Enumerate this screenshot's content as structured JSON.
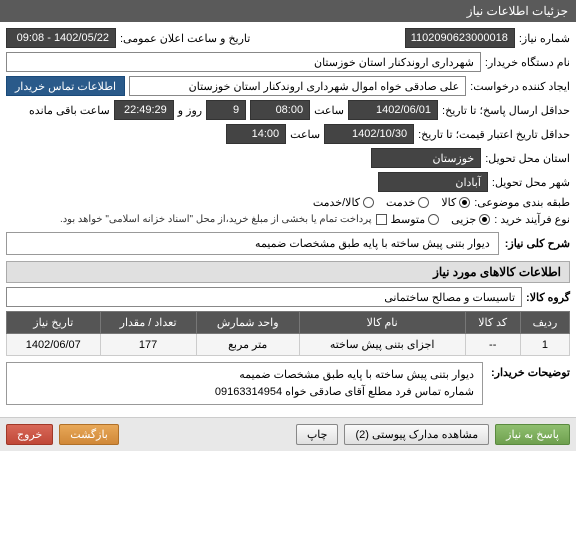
{
  "header": {
    "title": "جزئیات اطلاعات نیاز"
  },
  "fields": {
    "need_number_label": "شماره نیاز:",
    "need_number": "1102090623000018",
    "announce_label": "تاریخ و ساعت اعلان عمومی:",
    "announce_value": "1402/05/22 - 09:08",
    "buyer_org_label": "نام دستگاه خریدار:",
    "buyer_org": "شهرداری اروندکنار استان خوزستان",
    "requester_label": "ایجاد کننده درخواست:",
    "requester": "علی صادقی خواه اموال شهرداری اروندکنار استان خوزستان",
    "contact_btn": "اطلاعات تماس خریدار",
    "deadline_label": "حداقل ارسال پاسخ؛ تا تاریخ:",
    "deadline_date": "1402/06/01",
    "time_label": "ساعت",
    "deadline_time": "08:00",
    "days_value": "9",
    "days_label": "روز و",
    "remain_time": "22:49:29",
    "remain_label": "ساعت باقی مانده",
    "validity_label": "حداقل تاریخ اعتبار قیمت؛ تا تاریخ:",
    "validity_date": "1402/10/30",
    "validity_time": "14:00",
    "province_label": "استان محل تحویل:",
    "province": "خوزستان",
    "city_label": "شهر محل تحویل:",
    "city": "آبادان",
    "category_label": "طبقه بندی موضوعی:",
    "cat_goods": "کالا",
    "cat_service": "خدمت",
    "cat_goods_service": "کالا/خدمت",
    "process_label": "نوع فرآیند خرید :",
    "proc_partial": "جزیی",
    "proc_medium": "متوسط",
    "payment_note": "پرداخت تمام یا بخشی از مبلغ خرید،از محل \"اسناد خزانه اسلامی\" خواهد بود."
  },
  "desc": {
    "title_label": "شرح کلی نیاز:",
    "title_text": "دیوار بتنی پیش ساخته با پایه طبق مشخصات ضمیمه"
  },
  "items_section": {
    "heading": "اطلاعات کالاهای مورد نیاز",
    "group_label": "گروه کالا:",
    "group_value": "تاسیسات و مصالح ساختمانی"
  },
  "table": {
    "headers": {
      "row": "ردیف",
      "code": "کد کالا",
      "name": "نام کالا",
      "unit": "واحد شمارش",
      "qty": "تعداد / مقدار",
      "date": "تاریخ نیاز"
    },
    "rows": [
      {
        "row": "1",
        "code": "--",
        "name": "اجزای بتنی پیش ساخته",
        "unit": "متر مربع",
        "qty": "177",
        "date": "1402/06/07"
      }
    ]
  },
  "buyer_notes": {
    "label": "توضیحات خریدار:",
    "line1": "دیوار بتنی پیش ساخته با پایه طبق مشخصات ضمیمه",
    "line2": "شماره تماس فرد مطلع آقای صادقی خواه 09163314954"
  },
  "footer": {
    "respond": "پاسخ به نیاز",
    "attachments": "مشاهده مدارک پیوستی (2)",
    "print": "چاپ",
    "back": "بازگشت",
    "exit": "خروج"
  }
}
